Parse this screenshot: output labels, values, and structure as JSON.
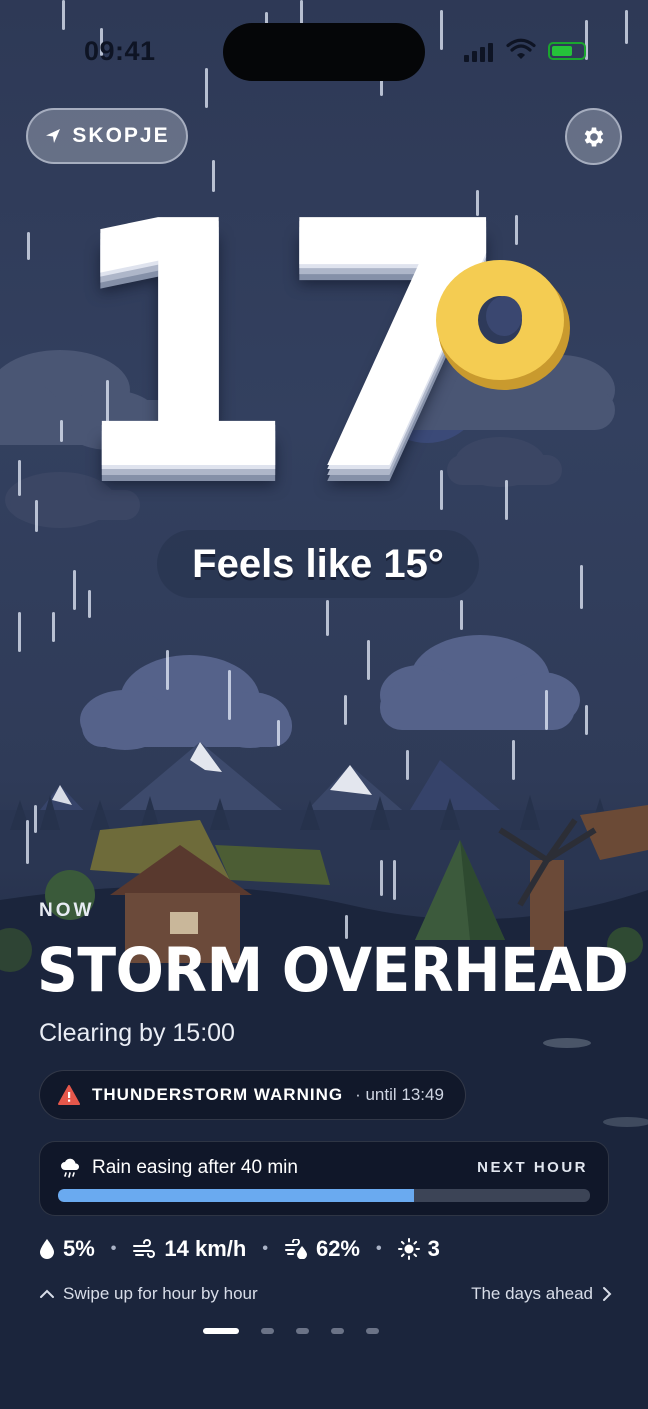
{
  "status_bar": {
    "time": "09:41"
  },
  "location": {
    "label": "SKOPJE"
  },
  "temperature": {
    "value": "17",
    "feels_like": "Feels like 15°"
  },
  "now": {
    "label": "NOW",
    "headline": "STORM OVERHEAD",
    "subline": "Clearing by 15:00"
  },
  "warning": {
    "title": "THUNDERSTORM WARNING",
    "until": "· until 13:49"
  },
  "next_hour": {
    "title": "Rain easing after 40 min",
    "label": "NEXT HOUR",
    "progress": 0.67
  },
  "stats": {
    "precipitation": "5%",
    "wind": "14 km/h",
    "humidity": "62%",
    "uv": "3"
  },
  "footer": {
    "swipe": "Swipe up for hour by hour",
    "days": "The days ahead"
  },
  "pager": {
    "count": 5,
    "active": 0
  },
  "colors": {
    "accent_bar": "#6aaaf0",
    "warning_icon": "#e5574b",
    "degree_ring": "#f4cc52"
  }
}
